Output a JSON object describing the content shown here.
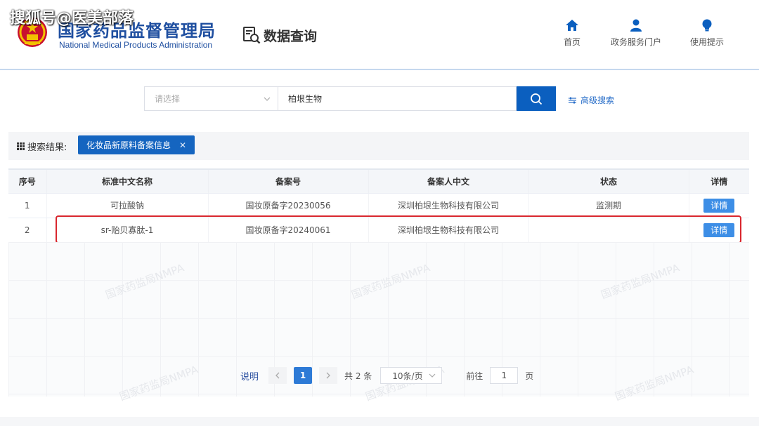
{
  "watermark_top": "搜狐号@医美部落",
  "brand": {
    "name_cn": "国家药品监督管理局",
    "name_en": "National Medical Products Administration"
  },
  "header": {
    "section_title": "数据查询",
    "nav": [
      {
        "label": "首页",
        "icon": "home-icon"
      },
      {
        "label": "政务服务门户",
        "icon": "user-icon"
      },
      {
        "label": "使用提示",
        "icon": "lightbulb-icon"
      }
    ]
  },
  "search": {
    "select_placeholder": "请选择",
    "query": "柏垠生物",
    "advanced_label": "高级搜索"
  },
  "results": {
    "label": "搜索结果:",
    "tag": "化妆品新原料备案信息"
  },
  "table": {
    "headers": [
      "序号",
      "标准中文名称",
      "备案号",
      "备案人中文",
      "状态",
      "详情"
    ],
    "detail_label": "详情",
    "rows": [
      {
        "no": "1",
        "name": "可拉酸钠",
        "record_no": "国妆原备字20230056",
        "applicant": "深圳柏垠生物科技有限公司",
        "status": "监测期"
      },
      {
        "no": "2",
        "name": "sr-贻贝寡肽-1",
        "record_no": "国妆原备字20240061",
        "applicant": "深圳柏垠生物科技有限公司",
        "status": ""
      }
    ]
  },
  "pagination": {
    "note": "说明",
    "current_page": "1",
    "total": "共 2 条",
    "page_size": "10条/页",
    "goto_label": "前往",
    "goto_value": "1",
    "page_unit": "页"
  },
  "background_watermark": "国家药监局NMPA",
  "colors": {
    "brand_blue": "#1f4fa0",
    "button_blue": "#0b5fbf",
    "tag_blue": "#1565c0",
    "highlight_red": "#d9272e"
  }
}
